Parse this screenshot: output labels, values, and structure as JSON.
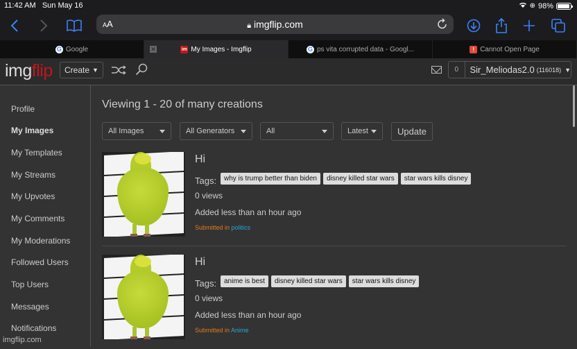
{
  "status_bar": {
    "time": "11:42 AM",
    "date": "Sun May 16",
    "battery": "98%",
    "battery_fraction": 0.98
  },
  "browser": {
    "url": "imgflip.com",
    "text_size_label": "AA",
    "tabs": [
      {
        "title": "Google",
        "favicon": "G",
        "active": false
      },
      {
        "title": "My Images - Imgflip",
        "favicon": "im",
        "active": true
      },
      {
        "title": "ps vita corrupted data - Googl...",
        "favicon": "G",
        "active": false
      },
      {
        "title": "Cannot Open Page",
        "favicon": "!",
        "active": false
      }
    ]
  },
  "header": {
    "logo_main": "img",
    "logo_accent": "flip",
    "create_label": "Create",
    "notification_count": "0",
    "username": "Sir_Meliodas2.0",
    "points": "(116018)"
  },
  "sidebar": {
    "items": [
      {
        "label": "Profile"
      },
      {
        "label": "My Images",
        "active": true
      },
      {
        "label": "My Templates"
      },
      {
        "label": "My Streams"
      },
      {
        "label": "My Upvotes"
      },
      {
        "label": "My Comments"
      },
      {
        "label": "My Moderations"
      },
      {
        "label": "Followed Users"
      },
      {
        "label": "Top Users"
      },
      {
        "label": "Messages"
      },
      {
        "label": "Notifications"
      }
    ],
    "footer": "imgflip.com"
  },
  "main": {
    "title": "Viewing 1 - 20 of many creations",
    "filters": {
      "type": "All Images",
      "generator": "All Generators",
      "scope": "All",
      "sort": "Latest",
      "update_label": "Update"
    },
    "posts": [
      {
        "title": "Hi",
        "tags_label": "Tags:",
        "tags": [
          "why is trump better than biden",
          "disney killed star wars",
          "star wars kills disney"
        ],
        "views": "0 views",
        "added": "Added less than an hour ago",
        "submitted_prefix": "Submitted in",
        "stream": "politics"
      },
      {
        "title": "Hi",
        "tags_label": "Tags:",
        "tags": [
          "anime is best",
          "disney killed star wars",
          "star wars kills disney"
        ],
        "views": "0 views",
        "added": "Added less than an hour ago",
        "submitted_prefix": "Submitted in",
        "stream": "Anime"
      }
    ]
  },
  "colors": {
    "brand": "#c0161c",
    "submitted": "#e07b1e",
    "stream_link": "#2aa5d6",
    "ios_accent": "#3a82f7"
  }
}
